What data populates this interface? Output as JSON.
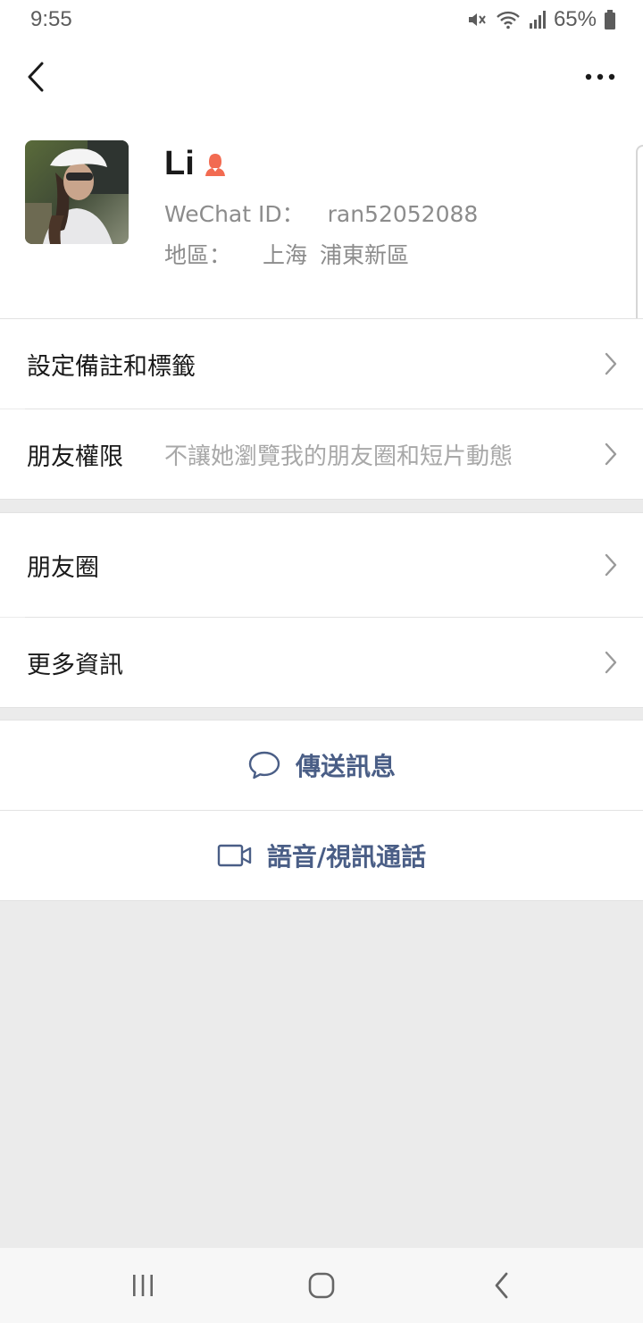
{
  "status_bar": {
    "time": "9:55",
    "battery": "65%",
    "icons": [
      "mute-icon",
      "wifi-icon",
      "signal-icon",
      "battery-icon"
    ]
  },
  "top_bar": {
    "back_icon": "chevron-left-icon",
    "more_icon": "more-dots-icon"
  },
  "profile": {
    "name": "Li",
    "gender_icon": "female-icon",
    "wechat_id_label": "WeChat ID：",
    "wechat_id": "ran52052088",
    "region_label": "地區：",
    "region_city": "上海",
    "region_district": "浦東新區"
  },
  "settings": {
    "remarks_label": "設定備註和標籤",
    "permissions_label": "朋友權限",
    "permissions_value": "不讓她瀏覽我的朋友圈和短片動態",
    "moments_label": "朋友圈",
    "more_info_label": "更多資訊"
  },
  "actions": {
    "send_message": "傳送訊息",
    "voice_video_call": "語音/視訊通話"
  },
  "colors": {
    "action_text": "#4a5e86",
    "gender_icon": "#f26b51",
    "page_background": "#ebebeb"
  }
}
